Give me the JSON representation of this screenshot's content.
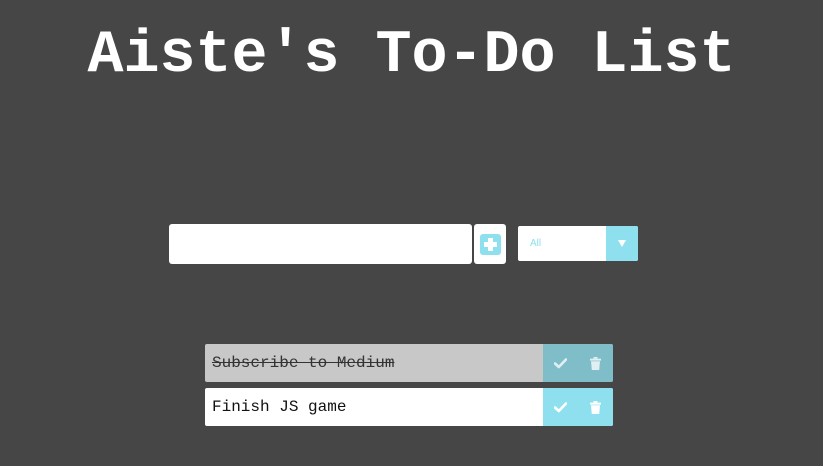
{
  "header": {
    "title": "Aiste's To-Do List"
  },
  "input": {
    "value": "",
    "placeholder": ""
  },
  "add_button": {
    "icon": "plus-square-icon"
  },
  "filter": {
    "selected": "All",
    "icon": "caret-down-icon"
  },
  "todos": [
    {
      "text": "Subscribe to Medium",
      "completed": true
    },
    {
      "text": "Finish JS game",
      "completed": false
    }
  ],
  "colors": {
    "background": "#464646",
    "accent": "#8ee0ef",
    "accent_muted": "#7fbec9",
    "completed_bg": "#c8c8c8",
    "item_bg": "#ffffff"
  }
}
